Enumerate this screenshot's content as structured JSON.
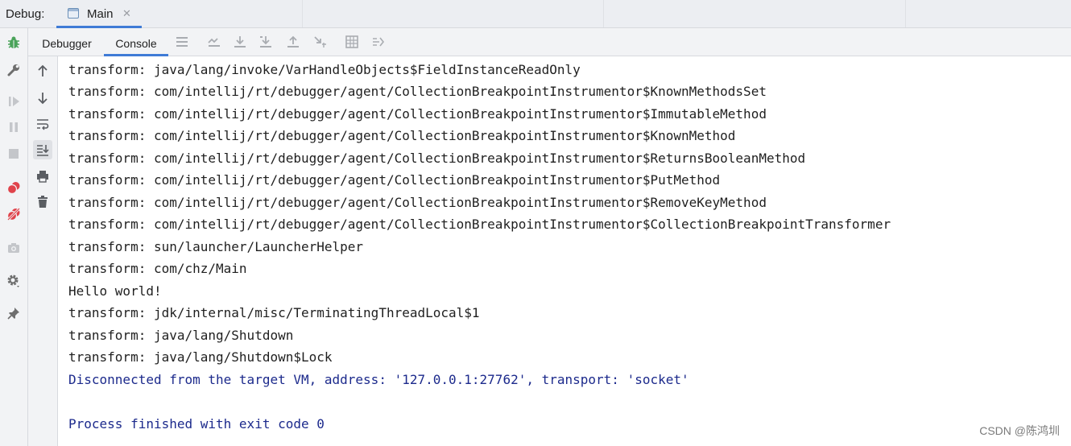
{
  "title_bar": {
    "debug_label": "Debug:",
    "tab_label": "Main",
    "tab_close_glyph": "✕"
  },
  "toolbar": {
    "tabs": [
      {
        "label": "Debugger",
        "active": false
      },
      {
        "label": "Console",
        "active": true
      }
    ],
    "icons": [
      "menu-icon",
      "show-execution-point-icon",
      "step-over-icon",
      "step-into-icon",
      "step-out-icon",
      "run-to-cursor-icon",
      "evaluate-expression-icon",
      "trace-icon"
    ]
  },
  "left_strip": {
    "icons": [
      "bug-icon",
      "wrench-icon",
      "resume-icon",
      "pause-icon",
      "stop-icon",
      "view-breakpoints-icon",
      "mute-breakpoints-icon",
      "camera-icon",
      "settings-icon",
      "pin-icon"
    ]
  },
  "console_gutter": {
    "icons": [
      "up-arrow-icon",
      "down-arrow-icon",
      "soft-wrap-icon",
      "scroll-to-end-icon",
      "print-icon",
      "trash-icon"
    ]
  },
  "console": {
    "lines": [
      {
        "text": "transform: java/lang/invoke/VarHandleObjects$FieldInstanceReadOnly",
        "kind": "stdout"
      },
      {
        "text": "transform: com/intellij/rt/debugger/agent/CollectionBreakpointInstrumentor$KnownMethodsSet",
        "kind": "stdout"
      },
      {
        "text": "transform: com/intellij/rt/debugger/agent/CollectionBreakpointInstrumentor$ImmutableMethod",
        "kind": "stdout"
      },
      {
        "text": "transform: com/intellij/rt/debugger/agent/CollectionBreakpointInstrumentor$KnownMethod",
        "kind": "stdout"
      },
      {
        "text": "transform: com/intellij/rt/debugger/agent/CollectionBreakpointInstrumentor$ReturnsBooleanMethod",
        "kind": "stdout"
      },
      {
        "text": "transform: com/intellij/rt/debugger/agent/CollectionBreakpointInstrumentor$PutMethod",
        "kind": "stdout"
      },
      {
        "text": "transform: com/intellij/rt/debugger/agent/CollectionBreakpointInstrumentor$RemoveKeyMethod",
        "kind": "stdout"
      },
      {
        "text": "transform: com/intellij/rt/debugger/agent/CollectionBreakpointInstrumentor$CollectionBreakpointTransformer",
        "kind": "stdout"
      },
      {
        "text": "transform: sun/launcher/LauncherHelper",
        "kind": "stdout"
      },
      {
        "text": "transform: com/chz/Main",
        "kind": "stdout"
      },
      {
        "text": "Hello world!",
        "kind": "stdout"
      },
      {
        "text": "transform: jdk/internal/misc/TerminatingThreadLocal$1",
        "kind": "stdout"
      },
      {
        "text": "transform: java/lang/Shutdown",
        "kind": "stdout"
      },
      {
        "text": "transform: java/lang/Shutdown$Lock",
        "kind": "stdout"
      },
      {
        "text": "Disconnected from the target VM, address: '127.0.0.1:27762', transport: 'socket'",
        "kind": "system"
      },
      {
        "text": "",
        "kind": "system"
      },
      {
        "text": "Process finished with exit code 0",
        "kind": "system"
      }
    ]
  },
  "watermark": "CSDN @陈鸿圳",
  "colors": {
    "accent": "#3f7bd6",
    "system_text": "#1c2a8c",
    "stdout_text": "#1f1f1f",
    "panel_bg": "#f2f3f5",
    "bug_green": "#4aa35a",
    "breakpoint_red": "#e0434b"
  }
}
